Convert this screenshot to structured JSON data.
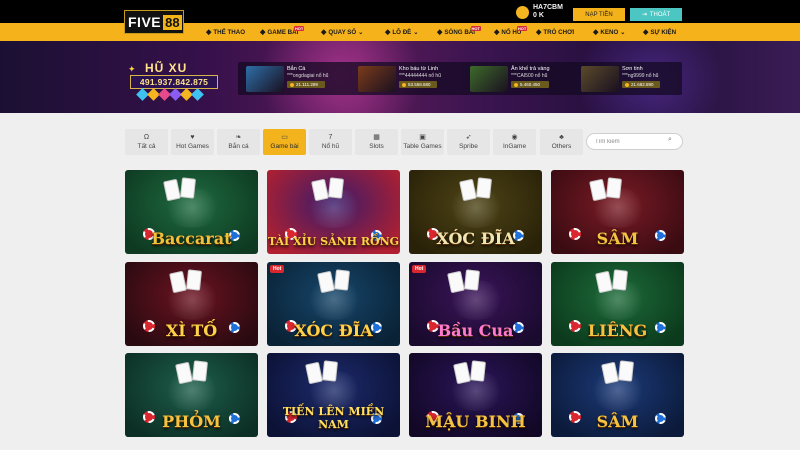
{
  "header": {
    "logo": {
      "text_1": "FIVE",
      "text_2": "88"
    },
    "user": {
      "name": "HA7CBM",
      "balance": "0 K"
    },
    "deposit_label": "NẠP TIỀN",
    "logout_label": "THOÁT"
  },
  "nav": [
    {
      "label": "THỂ THAO",
      "icon": "soccer-ball-icon"
    },
    {
      "label": "GAME BÀI",
      "icon": "cards-icon",
      "hot": true
    },
    {
      "label": "QUAY SỐ",
      "icon": "lottery-ball-icon",
      "dropdown": true
    },
    {
      "label": "LÔ ĐỀ",
      "icon": "lo-de-icon",
      "dropdown": true
    },
    {
      "label": "SÒNG BÀI",
      "icon": "casino-icon",
      "hot": true
    },
    {
      "label": "NỔ HŨ",
      "icon": "jackpot-icon",
      "hot": true
    },
    {
      "label": "TRÒ CHƠI",
      "icon": "gamepad-icon"
    },
    {
      "label": "KENO",
      "icon": "keno-icon",
      "dropdown": true
    },
    {
      "label": "SỰ KIỆN",
      "icon": "gift-icon"
    }
  ],
  "nav_hot_label": "HOT",
  "jackpot": {
    "title": "HŨ XU",
    "value": "491.937.842.875"
  },
  "winners": [
    {
      "game": "Bắn Cá",
      "user": "***ongdagiai",
      "action": "nổ hũ",
      "amount": "21.111.289",
      "thumb_color": "#2d6fa8"
    },
    {
      "game": "Kho báu từ Linh",
      "user": "***44444444",
      "action": "nổ hũ",
      "amount": "53.558.680",
      "thumb_color": "#7a3b1a"
    },
    {
      "game": "Ăn khế trả vàng",
      "user": "***CAI500",
      "action": "nổ hũ",
      "amount": "5.460.450",
      "thumb_color": "#3d6a2a"
    },
    {
      "game": "Sơn tinh",
      "user": "***ng9999",
      "action": "nổ hũ",
      "amount": "21.682.890",
      "thumb_color": "#5a4a2a"
    }
  ],
  "tabs": [
    {
      "label": "Tất cả",
      "icon": "headset-icon"
    },
    {
      "label": "Hot Games",
      "icon": "heart-icon"
    },
    {
      "label": "Bắn cá",
      "icon": "fish-icon"
    },
    {
      "label": "Game bài",
      "icon": "cards-icon",
      "active": true
    },
    {
      "label": "Nổ hũ",
      "icon": "seven-icon"
    },
    {
      "label": "Slots",
      "icon": "slot-icon"
    },
    {
      "label": "Table Games",
      "icon": "table-icon"
    },
    {
      "label": "Spribe",
      "icon": "rocket-icon"
    },
    {
      "label": "InGame",
      "icon": "ingame-icon"
    },
    {
      "label": "Others",
      "icon": "club-icon"
    }
  ],
  "search": {
    "placeholder": "Tìm kiếm"
  },
  "games": [
    {
      "title": "Baccarat",
      "bg1": "#1e6b3f",
      "bg2": "#0e3a22",
      "title_color": "#f0c23c",
      "hot": false
    },
    {
      "title": "TÀI XỈU SẢNH RỒNG",
      "bg1": "#3a1b6b",
      "bg2": "#b02030",
      "title_color": "#ffd24a",
      "hot": false
    },
    {
      "title": "XÓC ĐĨA",
      "bg1": "#4d4416",
      "bg2": "#2a2208",
      "title_color": "#f2e6b0",
      "hot": false
    },
    {
      "title": "SÂM",
      "bg1": "#7a1b25",
      "bg2": "#3b0b12",
      "title_color": "#f5c342",
      "hot": false
    },
    {
      "title": "XÌ TỐ",
      "bg1": "#6b1321",
      "bg2": "#2a0a10",
      "title_color": "#ffd24a",
      "hot": false
    },
    {
      "title": "XÓC ĐĨA",
      "bg1": "#16466a",
      "bg2": "#0a2236",
      "title_color": "#ffd24a",
      "hot": true
    },
    {
      "title": "Bầu Cua",
      "bg1": "#3a1458",
      "bg2": "#1a0a2e",
      "title_color": "#ff7ad0",
      "hot": true
    },
    {
      "title": "LIÊNG",
      "bg1": "#1e6b3a",
      "bg2": "#0b3a1c",
      "title_color": "#f5c342",
      "hot": false
    },
    {
      "title": "PHỎM",
      "bg1": "#1d5e4a",
      "bg2": "#0c2f25",
      "title_color": "#f5c342",
      "hot": false
    },
    {
      "title": "TIẾN LÊN MIỀN NAM",
      "bg1": "#1c2a6b",
      "bg2": "#0c1236",
      "title_color": "#ffe060",
      "hot": false
    },
    {
      "title": "MẬU BINH",
      "bg1": "#2a1458",
      "bg2": "#120826",
      "title_color": "#f5c342",
      "hot": false
    },
    {
      "title": "SÂM",
      "bg1": "#1c3a78",
      "bg2": "#0b1a3a",
      "title_color": "#f5c342",
      "hot": false
    }
  ],
  "hot_label": "Hot"
}
